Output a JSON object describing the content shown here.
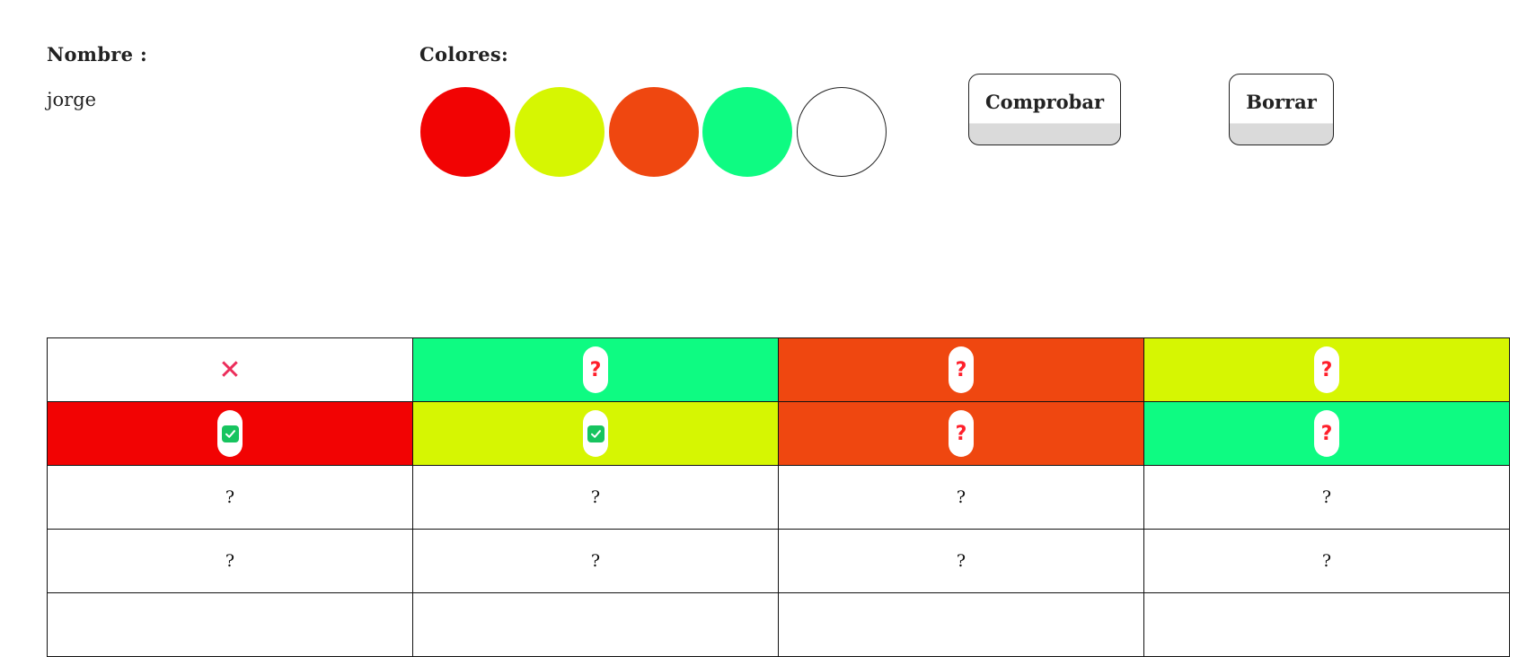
{
  "player": {
    "name_label": "Nombre :",
    "name_value": "jorge"
  },
  "palette": {
    "label": "Colores:",
    "colors": [
      "#f20303",
      "#d6f602",
      "#ef4710",
      "#0efb82",
      "#ffffff"
    ]
  },
  "actions": {
    "check_label": "Comprobar",
    "clear_label": "Borrar"
  },
  "board": {
    "rows": [
      [
        {
          "color": "#ffffff",
          "mark": "x-icon"
        },
        {
          "color": "#0efb82",
          "mark": "question-icon"
        },
        {
          "color": "#ef4710",
          "mark": "question-icon"
        },
        {
          "color": "#d6f602",
          "mark": "question-icon"
        }
      ],
      [
        {
          "color": "#f20303",
          "mark": "check-icon"
        },
        {
          "color": "#d6f602",
          "mark": "check-icon"
        },
        {
          "color": "#ef4710",
          "mark": "question-icon"
        },
        {
          "color": "#0efb82",
          "mark": "question-icon"
        }
      ],
      [
        {
          "color": "#ffffff",
          "mark": "text",
          "text": "?"
        },
        {
          "color": "#ffffff",
          "mark": "text",
          "text": "?"
        },
        {
          "color": "#ffffff",
          "mark": "text",
          "text": "?"
        },
        {
          "color": "#ffffff",
          "mark": "text",
          "text": "?"
        }
      ],
      [
        {
          "color": "#ffffff",
          "mark": "text",
          "text": "?"
        },
        {
          "color": "#ffffff",
          "mark": "text",
          "text": "?"
        },
        {
          "color": "#ffffff",
          "mark": "text",
          "text": "?"
        },
        {
          "color": "#ffffff",
          "mark": "text",
          "text": "?"
        }
      ],
      [
        {
          "color": "#ffffff",
          "mark": "text",
          "text": ""
        },
        {
          "color": "#ffffff",
          "mark": "text",
          "text": ""
        },
        {
          "color": "#ffffff",
          "mark": "text",
          "text": ""
        },
        {
          "color": "#ffffff",
          "mark": "text",
          "text": ""
        }
      ]
    ],
    "question_mark": "?"
  }
}
